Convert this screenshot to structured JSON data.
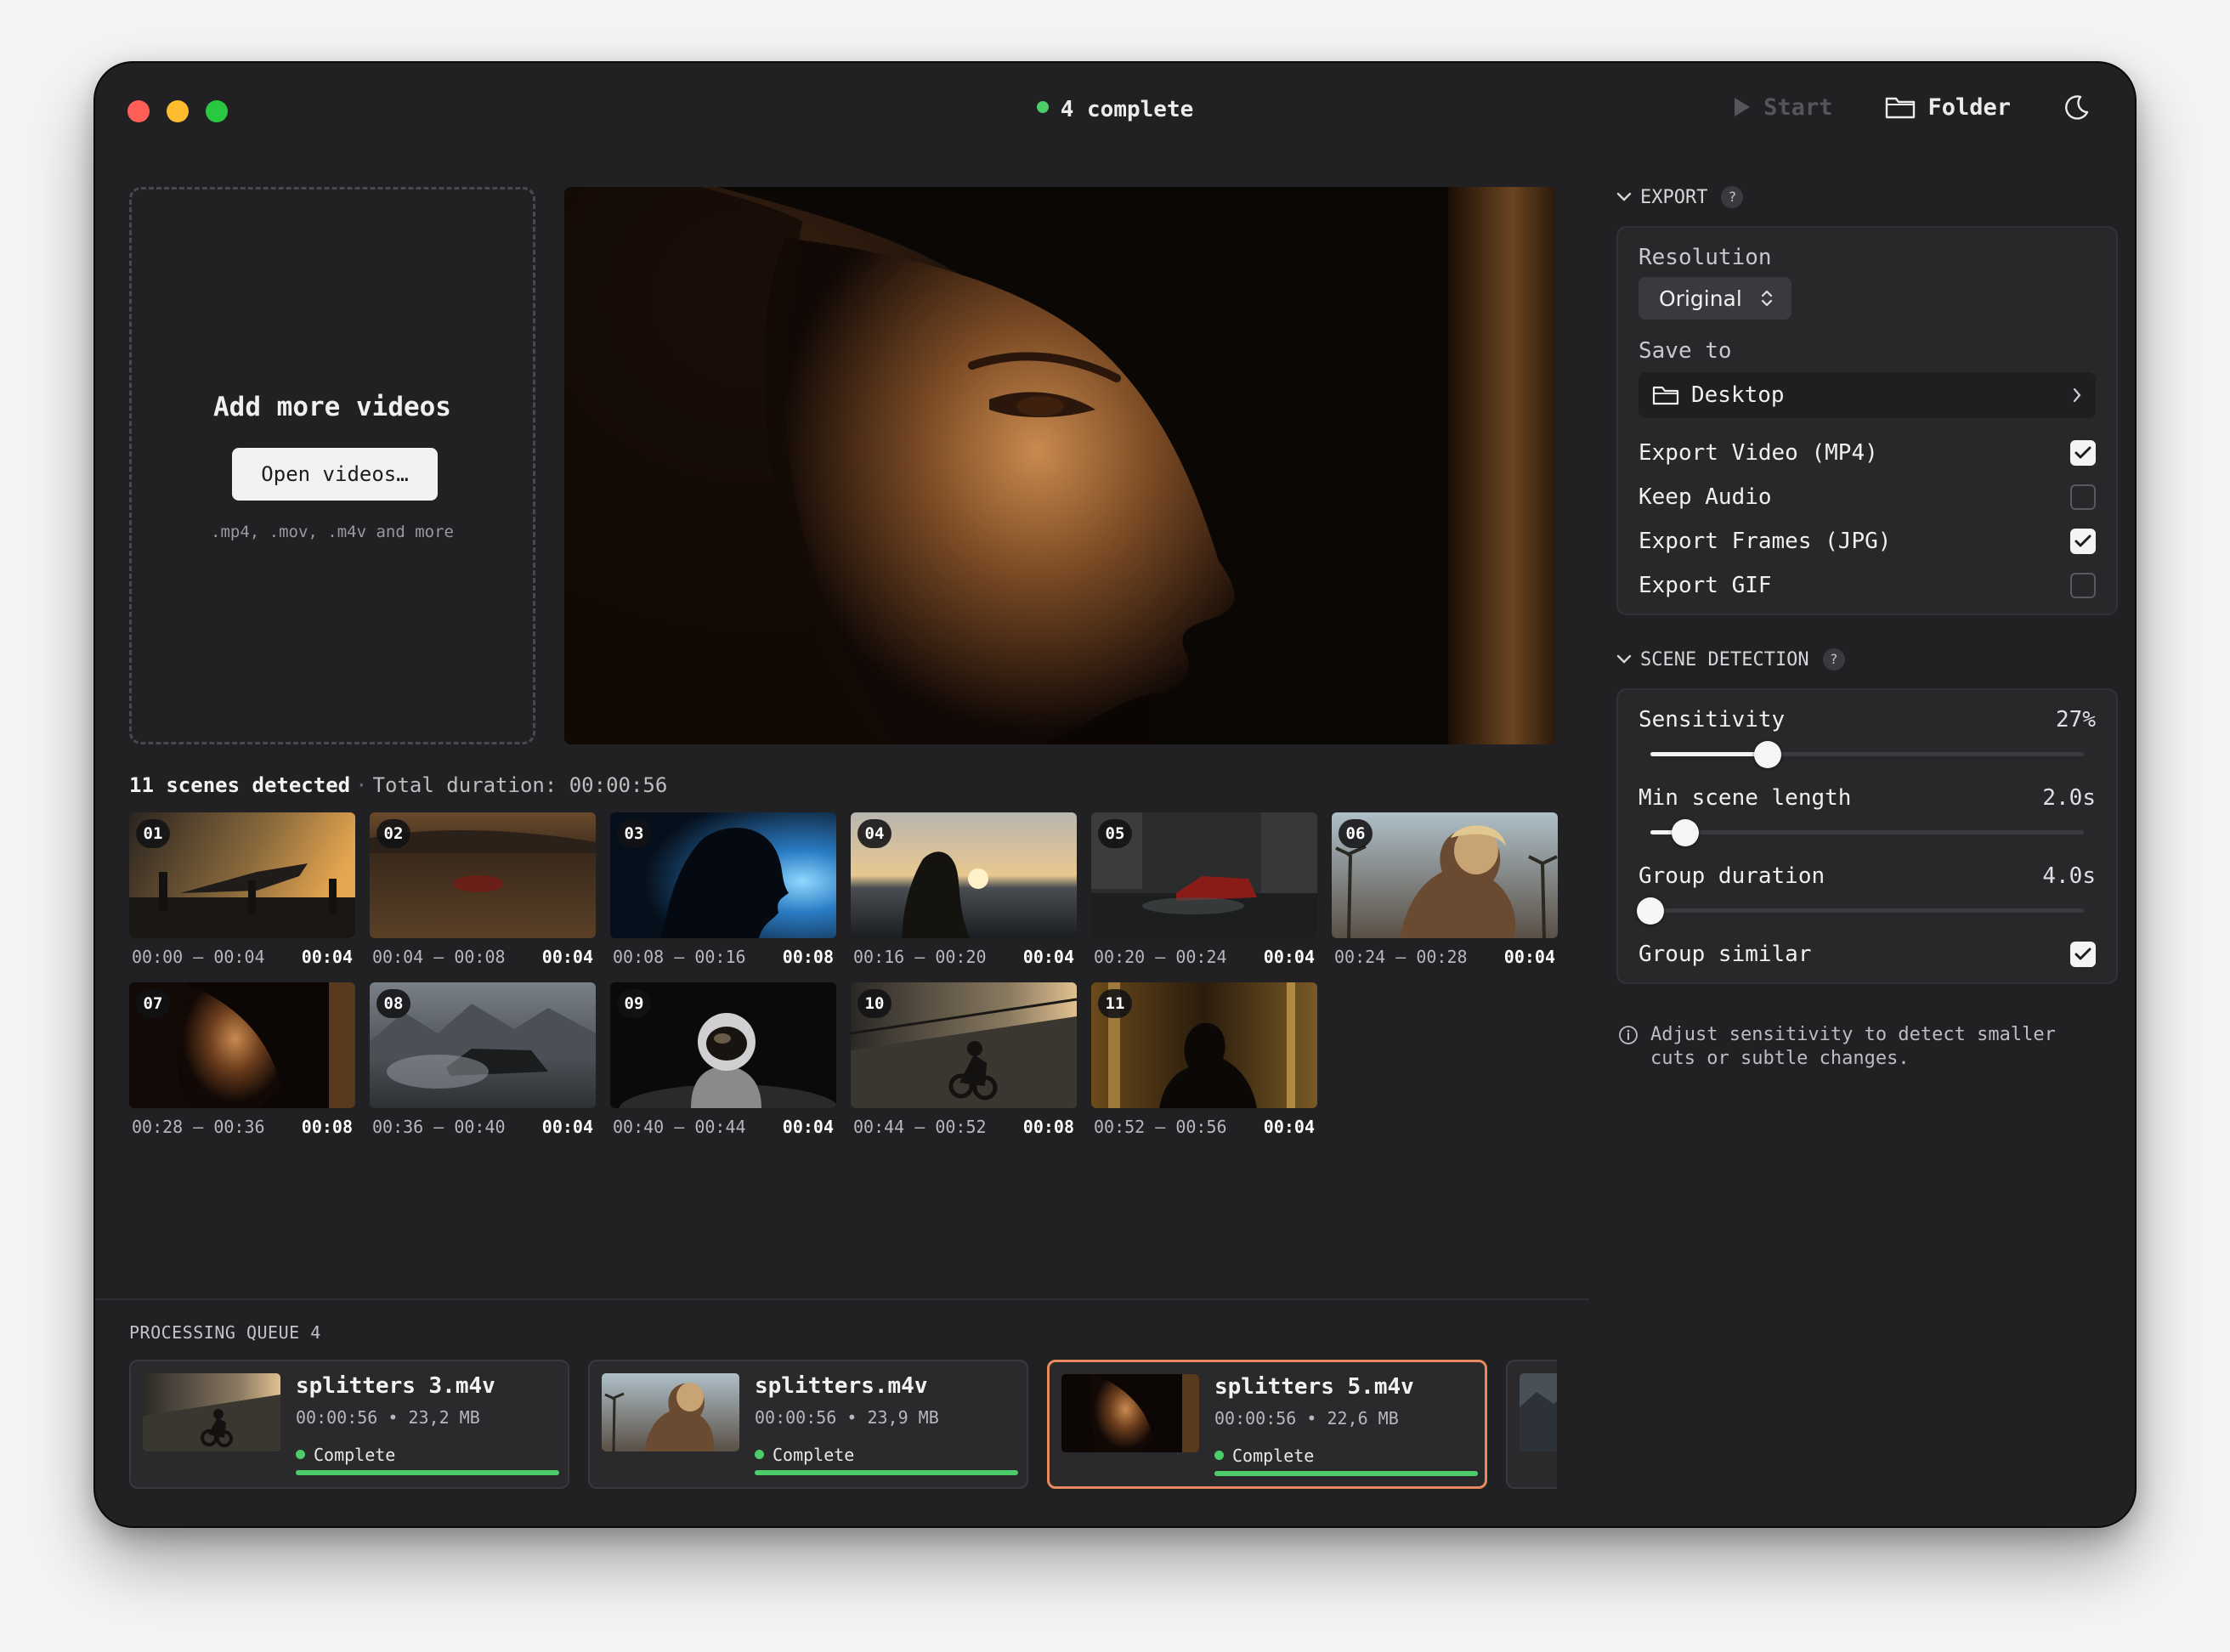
{
  "titlebar": {
    "status_text": "4 complete",
    "start_label": "Start",
    "folder_label": "Folder"
  },
  "dropzone": {
    "title": "Add more videos",
    "button_label": "Open videos…",
    "hint": ".mp4, .mov, .m4v and more"
  },
  "scenes": {
    "count_text": "11 scenes detected",
    "duration_text": "Total duration: 00:00:56",
    "items": [
      {
        "num": "01",
        "range": "00:00 – 00:04",
        "dur": "00:04"
      },
      {
        "num": "02",
        "range": "00:04 – 00:08",
        "dur": "00:04"
      },
      {
        "num": "03",
        "range": "00:08 – 00:16",
        "dur": "00:08"
      },
      {
        "num": "04",
        "range": "00:16 – 00:20",
        "dur": "00:04"
      },
      {
        "num": "05",
        "range": "00:20 – 00:24",
        "dur": "00:04"
      },
      {
        "num": "06",
        "range": "00:24 – 00:28",
        "dur": "00:04"
      },
      {
        "num": "07",
        "range": "00:28 – 00:36",
        "dur": "00:08"
      },
      {
        "num": "08",
        "range": "00:36 – 00:40",
        "dur": "00:04"
      },
      {
        "num": "09",
        "range": "00:40 – 00:44",
        "dur": "00:04"
      },
      {
        "num": "10",
        "range": "00:44 – 00:52",
        "dur": "00:08"
      },
      {
        "num": "11",
        "range": "00:52 – 00:56",
        "dur": "00:04"
      }
    ]
  },
  "queue": {
    "label": "PROCESSING QUEUE 4",
    "items": [
      {
        "name": "splitters 3.m4v",
        "info": "00:00:56 • 23,2 MB",
        "status": "Complete",
        "progress": 1.0
      },
      {
        "name": "splitters.m4v",
        "info": "00:00:56 • 23,9 MB",
        "status": "Complete",
        "progress": 1.0
      },
      {
        "name": "splitters 5.m4v",
        "info": "00:00:56 • 22,6 MB",
        "status": "Complete",
        "progress": 1.0
      }
    ]
  },
  "export": {
    "header": "EXPORT",
    "help": "?",
    "resolution_label": "Resolution",
    "resolution_value": "Original",
    "save_to_label": "Save to",
    "save_to_value": "Desktop",
    "options": [
      {
        "label": "Export Video (MP4)",
        "checked": true
      },
      {
        "label": "Keep Audio",
        "checked": false
      },
      {
        "label": "Export Frames (JPG)",
        "checked": true
      },
      {
        "label": "Export GIF",
        "checked": false
      }
    ]
  },
  "scene_detection": {
    "header": "SCENE DETECTION",
    "help": "?",
    "sensitivity_label": "Sensitivity",
    "sensitivity_value": "27%",
    "sensitivity_level": 0.27,
    "min_scene_label": "Min scene length",
    "min_scene_value": "2.0s",
    "min_scene_level": 0.08,
    "group_duration_label": "Group duration",
    "group_duration_value": "4.0s",
    "group_duration_level": 0.0,
    "group_similar_label": "Group similar",
    "group_similar_checked": true
  },
  "tip": {
    "line1": "Adjust sensitivity to detect smaller",
    "line2": "cuts or subtle changes."
  },
  "colors": {
    "accent_green": "#4ccd6a",
    "active_border": "#e98a5e",
    "window_bg": "#212124"
  }
}
